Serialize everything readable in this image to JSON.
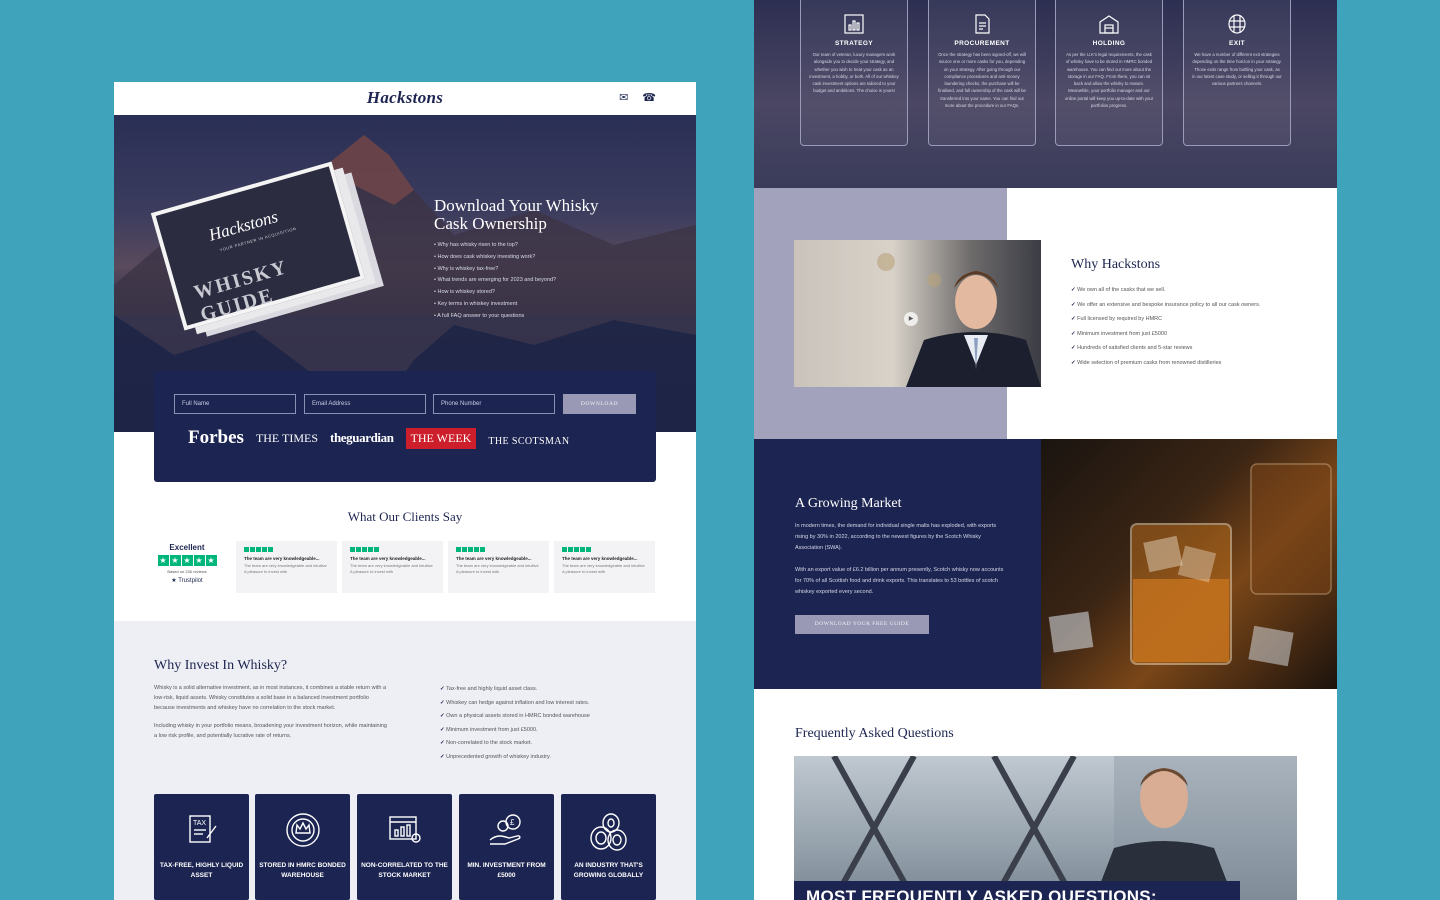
{
  "left": {
    "logo": "Hackstons",
    "nav_icons": [
      "envelope-icon",
      "phone-icon"
    ],
    "hero": {
      "guide_logo": "Hackstons",
      "guide_sub": "YOUR PARTNER IN ACQUISITION",
      "guide_title": "WHISKY GUIDE",
      "title": "Download Your Whisky Cask Ownership",
      "bullets": [
        "Why has whisky risen to the top?",
        "How does cask whiskey investing work?",
        "Why is whiskey tax-free?",
        "What trends are emerging for 2023 and beyond?",
        "How is whiskey stored?",
        "Key terms in whiskey investment",
        "A full FAQ answer to your questions"
      ]
    },
    "form": {
      "name_placeholder": "Full Name",
      "email_placeholder": "Email Address",
      "phone_placeholder": "Phone Number",
      "button": "DOWNLOAD"
    },
    "press": [
      "Forbes",
      "THE TIMES",
      "theguardian",
      "THE WEEK",
      "THE SCOTSMAN"
    ],
    "clients": {
      "title": "What Our Clients Say",
      "trustpilot": {
        "rating": "Excellent",
        "based": "Based on 236 reviews",
        "name": "Trustpilot"
      },
      "reviews": [
        {
          "title": "The team are very knowledgeable...",
          "body": "The team are very knowledgeable and intuitive A pleasure to invest with"
        },
        {
          "title": "The team are very knowledgeable...",
          "body": "The team are very knowledgeable and intuitive A pleasure to invest with"
        },
        {
          "title": "The team are very knowledgeable...",
          "body": "The team are very knowledgeable and intuitive A pleasure to invest with"
        },
        {
          "title": "The team are very knowledgeable...",
          "body": "The team are very knowledgeable and intuitive A pleasure to invest with"
        }
      ]
    },
    "why": {
      "title": "Why Invest In Whisky?",
      "p1": "Whisky is a solid alternative investment, as in most instances, it combines a stable return with a low-risk, liquid assets. Whisky constitutes a solid base in a balanced investment portfolio because investments and whiskey have no correlation to the stock market.",
      "p2": "Including whisky in your portfolio means, broadening your investment horizon, while maintaining a low risk profile, and potentially lucrative rate of returns.",
      "list": [
        "Tax-free and highly liquid asset class.",
        "Whiskey can hedge against inflation and low interest rates.",
        "Own a physical assets stored in HMRC bonded warehouse",
        "Minimum investment from just £5000.",
        "Non-correlated to the stock market.",
        "Unprecedented growth of whiskey industry."
      ]
    },
    "tiles": [
      {
        "label": "TAX-FREE, HIGHLY LIQUID ASSET",
        "icon": "tax-document-icon"
      },
      {
        "label": "STORED IN HMRC BONDED WAREHOUSE",
        "icon": "crown-seal-icon"
      },
      {
        "label": "NON-CORRELATED TO THE STOCK MARKET",
        "icon": "chart-report-icon"
      },
      {
        "label": "MIN. INVESTMENT FROM £5000",
        "icon": "hand-coins-icon"
      },
      {
        "label": "AN INDUSTRY THAT'S GROWING GLOBALLY",
        "icon": "barrels-icon"
      }
    ]
  },
  "right": {
    "steps": [
      {
        "title": "STRATEGY",
        "icon": "strategy-chart-icon",
        "body": "Our team of veteran, luxury managers work alongside you to decide your strategy, and whether you wish to treat your cask as an investment, a hobby, or both. All of our whiskey cask investment options are tailored to your budget and ambitions. The choice is yours!"
      },
      {
        "title": "PROCUREMENT",
        "icon": "document-icon",
        "body": "Once the strategy has been signed-off, we will source one or more casks for you, depending on your strategy. After going through our compliance procedures and anti-money laundering checks, the purchase will be finalised, and full ownership of the cask will be transferred into your name. You can find out more about the procedure in our FAQs."
      },
      {
        "title": "HOLDING",
        "icon": "warehouse-icon",
        "body": "As per the U.K's legal requirements, the cask of whisky have to be stored in HMRC bonded warehouse. You can find out more about the storage in our FAQ. From there, you can sit back and allow the whisky to mature. Meanwhile, your portfolio manager and our online portal will keep you up-to-date with your portfolios progress."
      },
      {
        "title": "EXIT",
        "icon": "barrel-icon",
        "body": "We have a number of different exit strategies depending on the time horizon in your strategy. Those exits range from bottling your cask, as in our latest case study, or selling it through our various partners channels."
      }
    ],
    "why_hackstons": {
      "title": "Why Hackstons",
      "list": [
        "We own all of the casks that we sell.",
        "We offer an extensive and bespoke insurance policy to all our cask owners.",
        "Full licensed by required by HMRC",
        "Minimum investment from just £5000",
        "Hundreds of satisfied clients and 5-star reviews",
        "Wide selection of premium casks from renowned distilleries"
      ]
    },
    "market": {
      "title": "A Growing Market",
      "p1": "In modern times, the demand for individual single malts has exploded, with exports rising by 30% in 2022, according to the newest figures by the Scotch Whisky Association (SWA).",
      "p2": "With an export value of £6.2 billion per annum presently, Scotch whisky now accounts for 70% of all Scottish food and drink exports. This translates to 53 bottles of scotch whiskey exported every second.",
      "button": "DOWNLOAD YOUR FREE GUIDE"
    },
    "faq": {
      "title": "Frequently Asked Questions",
      "banner": "MOST FREQUENTLY ASKED QUESTIONS:"
    }
  },
  "colors": {
    "background": "#3ea3bb",
    "navy": "#1c2552",
    "lavender": "#9a99b5",
    "trustpilot": "#00b67a",
    "week_red": "#cc1f2b"
  }
}
